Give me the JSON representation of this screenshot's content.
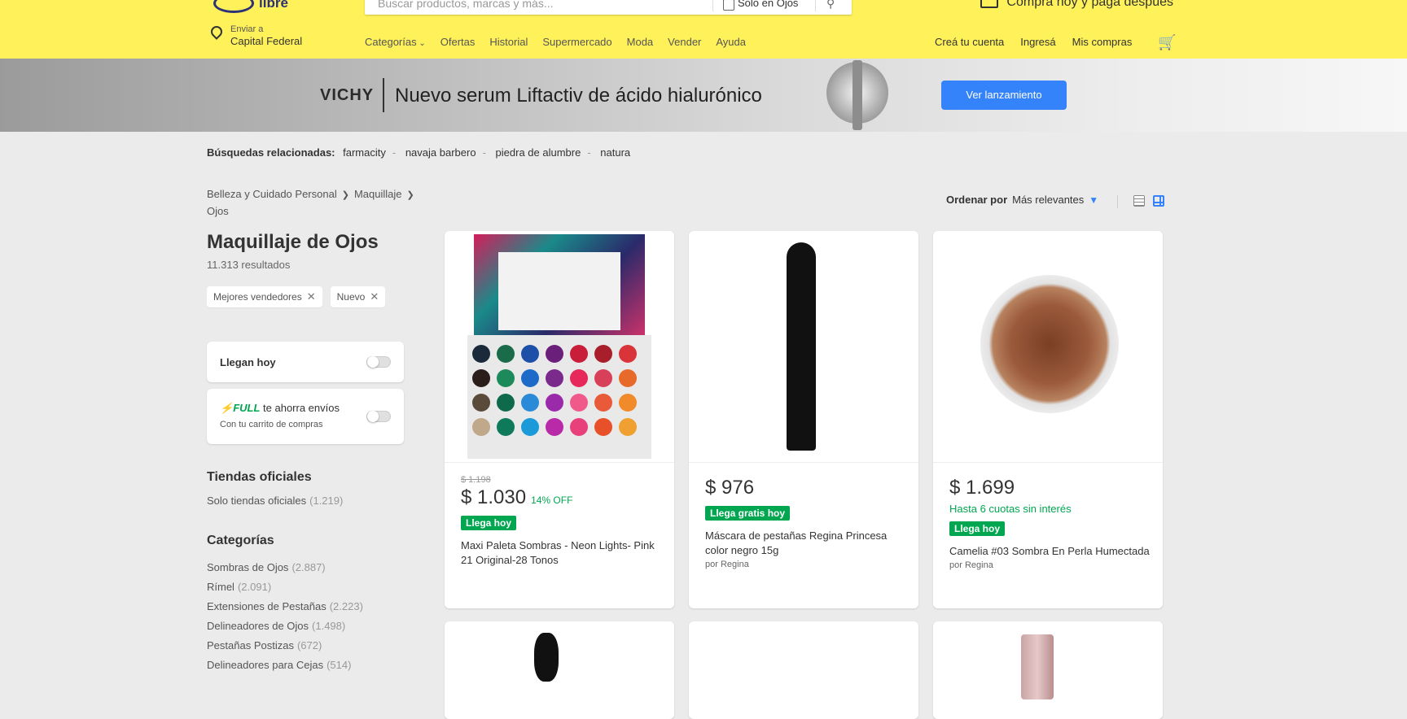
{
  "header": {
    "logo_word": "libre",
    "search_placeholder": "Buscar productos, marcas y más...",
    "search_scope": "Solo en Ojos",
    "promo": "Comprá hoy y pagá después",
    "location_label": "Enviar a",
    "location_value": "Capital Federal",
    "nav": [
      "Categorías",
      "Ofertas",
      "Historial",
      "Supermercado",
      "Moda",
      "Vender",
      "Ayuda"
    ],
    "account": [
      "Creá tu cuenta",
      "Ingresá",
      "Mis compras"
    ]
  },
  "banner": {
    "brand": "VICHY",
    "tagline": "Nuevo serum Liftactiv de ácido hialurónico",
    "cta": "Ver lanzamiento"
  },
  "related": {
    "label": "Búsquedas relacionadas:",
    "items": [
      "farmacity",
      "navaja barbero",
      "piedra de alumbre",
      "natura"
    ]
  },
  "breadcrumb": [
    "Belleza y Cuidado Personal",
    "Maquillaje",
    "Ojos"
  ],
  "page": {
    "title": "Maquillaje de Ojos",
    "results": "11.313 resultados"
  },
  "chips": [
    "Mejores vendedores",
    "Nuevo"
  ],
  "filters": {
    "llegan_hoy": "Llegan hoy",
    "full_word": "FULL",
    "full_text": "te ahorra envíos",
    "full_sub": "Con tu carrito de compras"
  },
  "tiendas": {
    "title": "Tiendas oficiales",
    "link": "Solo tiendas oficiales",
    "count": "(1.219)"
  },
  "categorias": {
    "title": "Categorías",
    "items": [
      {
        "name": "Sombras de Ojos",
        "count": "(2.887)"
      },
      {
        "name": "Rímel",
        "count": "(2.091)"
      },
      {
        "name": "Extensiones de Pestañas",
        "count": "(2.223)"
      },
      {
        "name": "Delineadores de Ojos",
        "count": "(1.498)"
      },
      {
        "name": "Pestañas Postizas",
        "count": "(672)"
      },
      {
        "name": "Delineadores para Cejas",
        "count": "(514)"
      }
    ]
  },
  "sort": {
    "label": "Ordenar por",
    "value": "Más relevantes"
  },
  "products": [
    {
      "old_price": "$ 1.198",
      "price": "$ 1.030",
      "discount": "14% OFF",
      "badge": "Llega hoy",
      "name": "Maxi Paleta Sombras - Neon Lights- Pink 21 Original-28 Tonos",
      "seller": ""
    },
    {
      "old_price": "",
      "price": "$ 976",
      "discount": "",
      "badge": "Llega gratis hoy",
      "name": "Máscara de pestañas Regina Princesa color negro 15g",
      "seller": "por Regina"
    },
    {
      "old_price": "",
      "price": "$ 1.699",
      "installments": "Hasta 6 cuotas sin interés",
      "badge": "Llega hoy",
      "name": "Camelia #03 Sombra En Perla Humectada",
      "seller": "por Regina"
    }
  ],
  "colors": {
    "header_yellow": "#fff159",
    "blue": "#3483fa",
    "green": "#00a650"
  }
}
